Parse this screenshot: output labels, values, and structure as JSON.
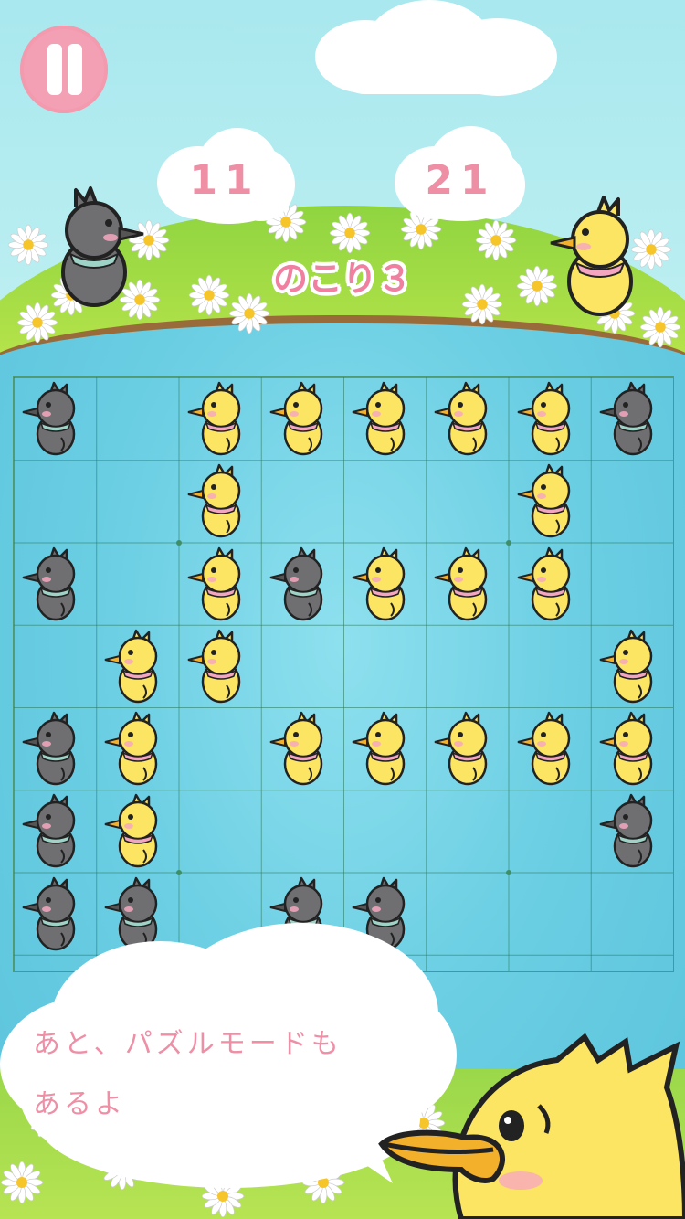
{
  "hud": {
    "pause_label": "II",
    "player_black_score": "11",
    "player_yellow_score": "21",
    "remaining_text": "のこり３"
  },
  "board": {
    "columns": 8,
    "rows": 7,
    "cells": [
      [
        "B",
        "",
        "Y",
        "Y",
        "Y",
        "Y",
        "Y",
        "B"
      ],
      [
        "",
        "",
        "Y",
        "",
        "",
        "",
        "Y",
        ""
      ],
      [
        "B",
        "",
        "Y",
        "B",
        "Y",
        "Y",
        "Y",
        ""
      ],
      [
        "",
        "Y",
        "Y",
        "",
        "",
        "",
        "",
        "Y"
      ],
      [
        "B",
        "Y",
        "",
        "Y",
        "Y",
        "Y",
        "Y",
        "Y"
      ],
      [
        "B",
        "Y",
        "",
        "",
        "",
        "",
        "",
        "B"
      ],
      [
        "B",
        "B",
        "",
        "B",
        "B",
        "",
        "",
        ""
      ]
    ],
    "legend": {
      "B": "black-duck",
      "Y": "yellow-duck"
    }
  },
  "speech": {
    "text": "あと、パズルモードも\nあるよ"
  },
  "colors": {
    "accent_pink": "#ee8fa6",
    "yellow_duck": "#fbe562",
    "black_duck": "#6f6f72",
    "grid": "#3e8e66"
  }
}
